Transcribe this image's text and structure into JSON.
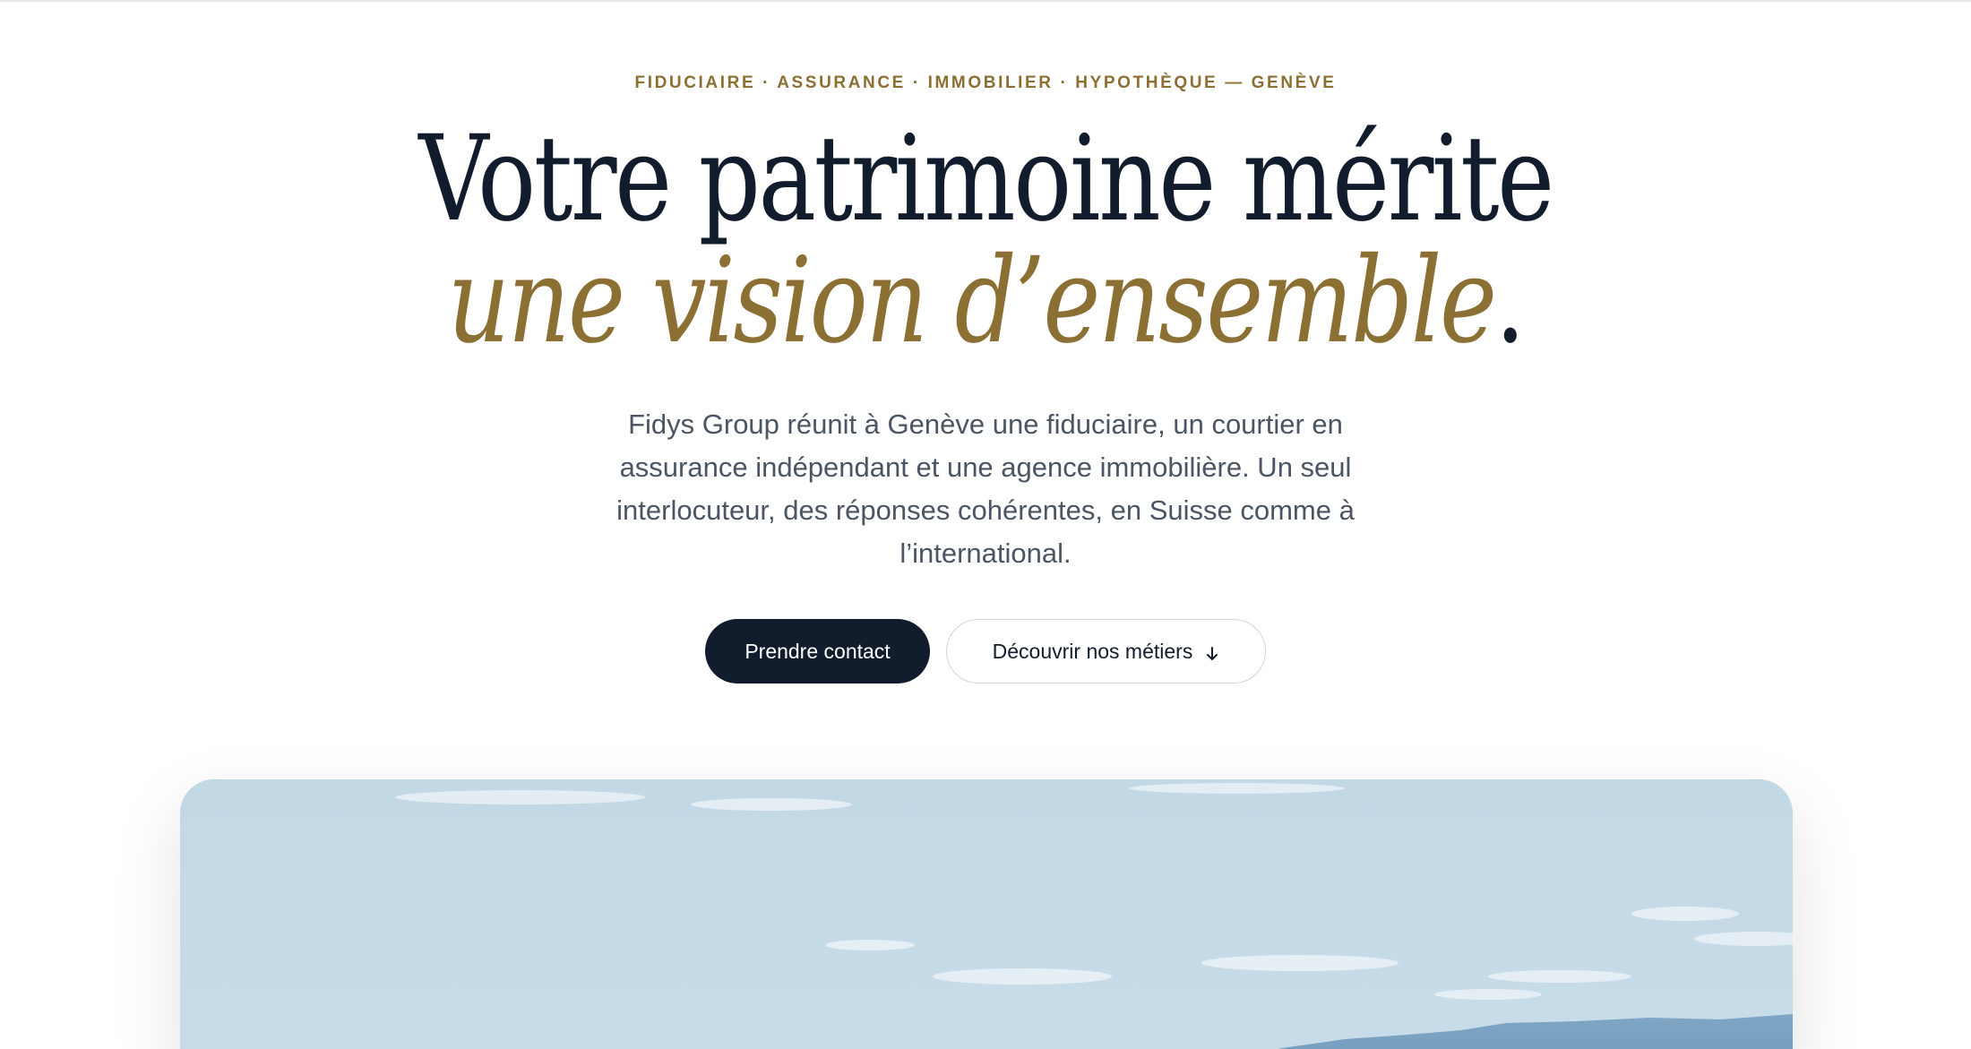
{
  "hero": {
    "eyebrow": "FIDUCIAIRE · ASSURANCE · IMMOBILIER · HYPOTHÈQUE — GENÈVE",
    "headline_line1": "Votre patrimoine mérite",
    "headline_accent": "une vision d’ensemble",
    "headline_period": ".",
    "lead": "Fidys Group réunit à Genève une fiduciaire, un courtier en assurance indépendant et une agence immobilière. Un seul interlocuteur, des réponses cohérentes, en Suisse comme à l’international.",
    "primary_cta": "Prendre contact",
    "secondary_cta": "Découvrir nos métiers",
    "secondary_cta_icon": "arrow-down-icon"
  },
  "colors": {
    "accent_gold": "#8b6f33",
    "navy": "#111c2d",
    "body_text": "#4b5563"
  },
  "image": {
    "description_icon": "lake-geneva-landscape"
  }
}
